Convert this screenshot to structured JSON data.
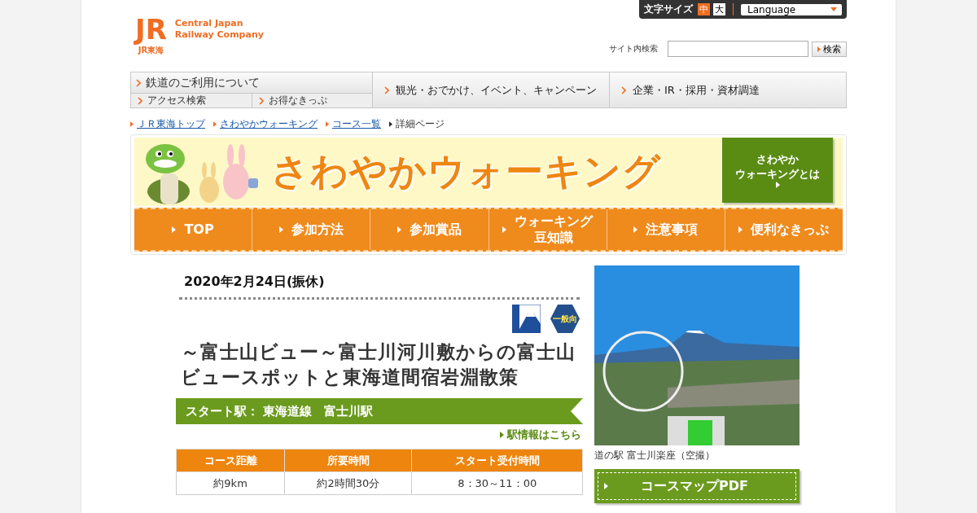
{
  "header": {
    "logo": {
      "mark": "JR",
      "sub": "JR東海"
    },
    "company_name": [
      "Central Japan",
      "Railway Company"
    ],
    "text_size": {
      "label": "文字サイズ",
      "options": [
        {
          "label": "中",
          "selected": true
        },
        {
          "label": "大",
          "selected": false
        }
      ]
    },
    "language": {
      "value": "Language"
    },
    "search": {
      "label": "サイト内検索",
      "button": "検索"
    }
  },
  "global_nav": [
    {
      "label": "鉄道のご利用について",
      "sub": [
        "アクセス検索",
        "お得なきっぷ"
      ]
    },
    {
      "label": "観光・おでかけ、イベント、キャンペーン"
    },
    {
      "label": "企業・IR・採用・資材調達"
    }
  ],
  "breadcrumb": [
    {
      "label": "ＪＲ東海トップ",
      "link": true
    },
    {
      "label": "さわやかウォーキング",
      "link": true
    },
    {
      "label": "コース一覧",
      "link": true
    },
    {
      "label": "詳細ページ",
      "link": false
    }
  ],
  "banner": {
    "title": "さわやかウォーキング",
    "about": [
      "さわやか",
      "ウォーキングとは"
    ]
  },
  "tabs": [
    {
      "lines": [
        "TOP"
      ]
    },
    {
      "lines": [
        "参加方法"
      ]
    },
    {
      "lines": [
        "参加賞品"
      ]
    },
    {
      "lines": [
        "ウォーキング",
        "豆知識"
      ]
    },
    {
      "lines": [
        "注意事項"
      ]
    },
    {
      "lines": [
        "便利なきっぷ"
      ]
    }
  ],
  "event": {
    "date": "2020年2月24日(振休)",
    "badges": [
      {
        "kind": "fuji"
      },
      {
        "kind": "level",
        "label": "一般向"
      }
    ],
    "title": "～富士山ビュー～富士川河川敷からの富士山ビュースポットと東海道間宿岩淵散策",
    "start_station": "スタート駅： 東海道線　富士川駅",
    "station_link": "駅情報はこちら",
    "table": {
      "columns": [
        "コース距離",
        "所要時間",
        "スタート受付時間"
      ],
      "rows": [
        [
          "約9km",
          "約2時間30分",
          "8：30～11：00"
        ]
      ]
    },
    "photo_caption": "道の駅 富士川楽座（空撮）",
    "map_button": "コースマップPDF"
  }
}
